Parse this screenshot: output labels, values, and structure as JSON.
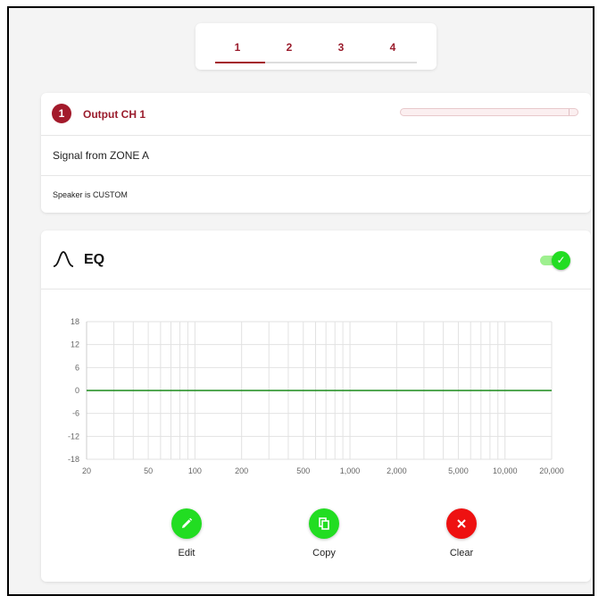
{
  "tabs": [
    {
      "label": "1",
      "active": true
    },
    {
      "label": "2",
      "active": false
    },
    {
      "label": "3",
      "active": false
    },
    {
      "label": "4",
      "active": false
    }
  ],
  "output": {
    "number": "1",
    "title": "Output CH 1",
    "signal": "Signal from ZONE A",
    "speaker": "Speaker is CUSTOM"
  },
  "eq": {
    "title": "EQ",
    "enabled": true,
    "icon": "bell-curve-icon",
    "toggle_icon": "check-icon"
  },
  "actions": {
    "edit": {
      "label": "Edit",
      "icon": "pencil-icon",
      "color": "#22dd22"
    },
    "copy": {
      "label": "Copy",
      "icon": "copy-icon",
      "color": "#22dd22"
    },
    "clear": {
      "label": "Clear",
      "icon": "close-icon",
      "color": "#ee1111"
    }
  },
  "colors": {
    "accent": "#a31a2b",
    "toggle_on": "#22dd22",
    "curve": "#1a8a1a"
  },
  "chart_data": {
    "type": "line",
    "title": "",
    "xlabel": "",
    "ylabel": "",
    "x_scale": "log",
    "xlim": [
      20,
      20000
    ],
    "ylim": [
      -18,
      18
    ],
    "x_ticks": [
      {
        "value": 20,
        "label": "20"
      },
      {
        "value": 50,
        "label": "50"
      },
      {
        "value": 100,
        "label": "100"
      },
      {
        "value": 200,
        "label": "200"
      },
      {
        "value": 500,
        "label": "500"
      },
      {
        "value": 1000,
        "label": "1,000"
      },
      {
        "value": 2000,
        "label": "2,000"
      },
      {
        "value": 5000,
        "label": "5,000"
      },
      {
        "value": 10000,
        "label": "10,000"
      },
      {
        "value": 20000,
        "label": "20,000"
      }
    ],
    "y_ticks": [
      18,
      12,
      6,
      0,
      -6,
      -12,
      -18
    ],
    "grid": true,
    "series": [
      {
        "x": [
          20,
          20000
        ],
        "y": [
          0,
          0
        ],
        "color": "#1a8a1a"
      }
    ]
  }
}
